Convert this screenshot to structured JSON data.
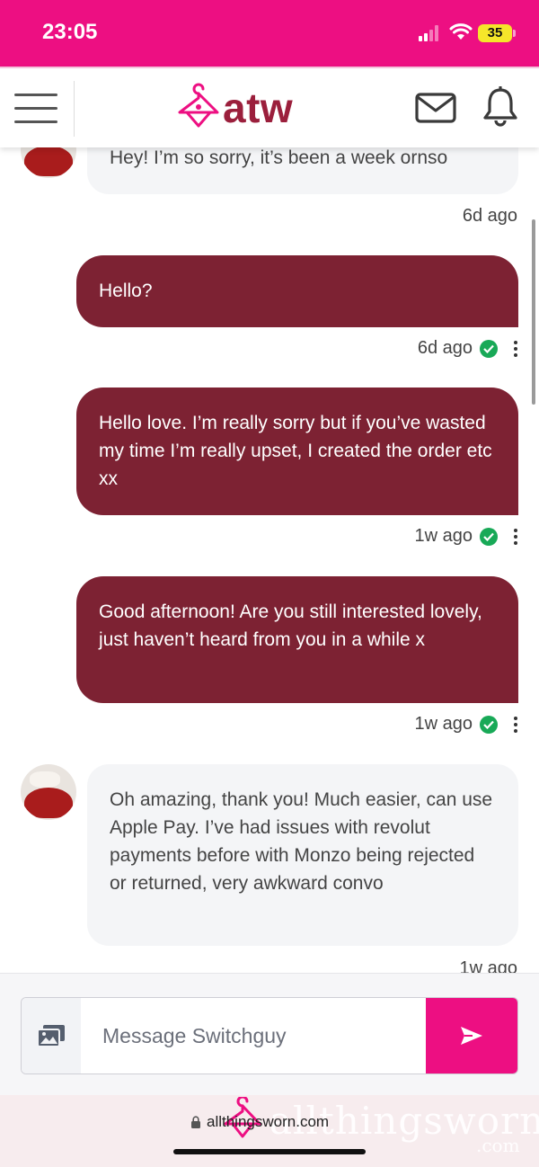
{
  "status_bar": {
    "time": "23:05",
    "battery": "35",
    "icons": [
      "signal-icon",
      "wifi-icon",
      "battery-icon"
    ]
  },
  "header": {
    "logo_text": "atw",
    "icons": [
      "menu-icon",
      "hanger-logo-icon",
      "mail-icon",
      "bell-icon"
    ]
  },
  "messages": [
    {
      "sender": "them",
      "text": "Hey! I’m so sorry, it’s been a week ornso",
      "time": "6d ago"
    },
    {
      "sender": "me",
      "text": "Hello?",
      "time": "6d ago"
    },
    {
      "sender": "me",
      "text": "Hello love. I’m really sorry but if you’ve wasted my time I’m really upset, I created the order etc xx",
      "time": "1w ago"
    },
    {
      "sender": "me",
      "text": "Good afternoon! Are you still interested lovely, just haven’t heard from you in a while x",
      "time": "1w ago"
    },
    {
      "sender": "them",
      "text": "Oh amazing, thank you! Much easier, can use Apple Pay. I’ve had issues with revolut payments before with Monzo being rejected or returned, very awkward convo",
      "time": "1w ago"
    }
  ],
  "compose": {
    "placeholder": "Message Switchguy"
  },
  "browser": {
    "url": "allthingsworn.com",
    "watermark": "allthingsworn",
    "watermark_suffix": ".com"
  },
  "colors": {
    "brand_pink": "#ed0f82",
    "bubble_mine": "#7d2233",
    "bubble_theirs": "#f4f5f7",
    "check_green": "#18a957",
    "logo_red": "#9b1f3c"
  }
}
